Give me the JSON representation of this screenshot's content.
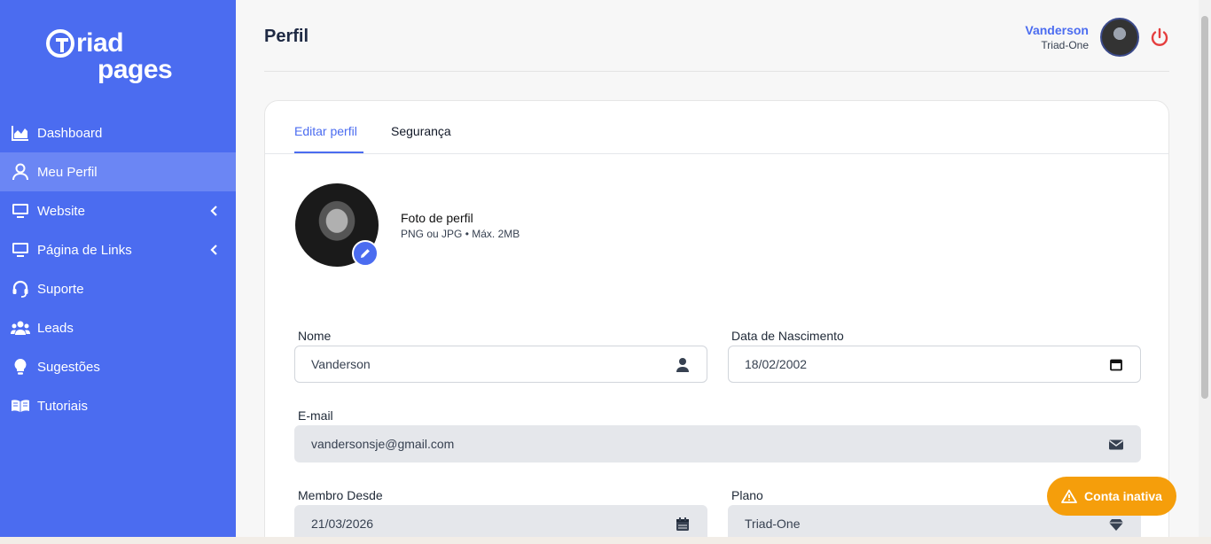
{
  "brand": {
    "line1": "riad",
    "line2": "pages"
  },
  "sidebar": {
    "items": [
      {
        "label": "Dashboard",
        "icon": "chart-area-icon",
        "active": false
      },
      {
        "label": "Meu Perfil",
        "icon": "user-icon",
        "active": true
      },
      {
        "label": "Website",
        "icon": "monitor-icon",
        "active": false,
        "expandable": true
      },
      {
        "label": "Página de Links",
        "icon": "monitor-icon",
        "active": false,
        "expandable": true
      },
      {
        "label": "Suporte",
        "icon": "headset-icon",
        "active": false
      },
      {
        "label": "Leads",
        "icon": "users-icon",
        "active": false
      },
      {
        "label": "Sugestões",
        "icon": "lightbulb-icon",
        "active": false
      },
      {
        "label": "Tutoriais",
        "icon": "book-open-icon",
        "active": false
      }
    ]
  },
  "header": {
    "title": "Perfil",
    "user_name": "Vanderson",
    "user_company": "Triad-One"
  },
  "tabs": [
    {
      "label": "Editar perfil",
      "active": true
    },
    {
      "label": "Segurança",
      "active": false
    }
  ],
  "photo": {
    "label": "Foto de perfil",
    "hint": "PNG ou JPG • Máx. 2MB"
  },
  "form": {
    "nome": {
      "label": "Nome",
      "value": "Vanderson"
    },
    "nascimento": {
      "label": "Data de Nascimento",
      "value": "18/02/2002"
    },
    "email": {
      "label": "E-mail",
      "value": "vandersonsje@gmail.com"
    },
    "membro": {
      "label": "Membro Desde",
      "value": "21/03/2026"
    },
    "plano": {
      "label": "Plano",
      "value": "Triad-One"
    }
  },
  "status_badge": {
    "label": "Conta inativa"
  },
  "colors": {
    "accent": "#4b6cf0",
    "sidebar": "#4b6cf0",
    "warning": "#f59e0b",
    "power": "#e53e3e"
  }
}
